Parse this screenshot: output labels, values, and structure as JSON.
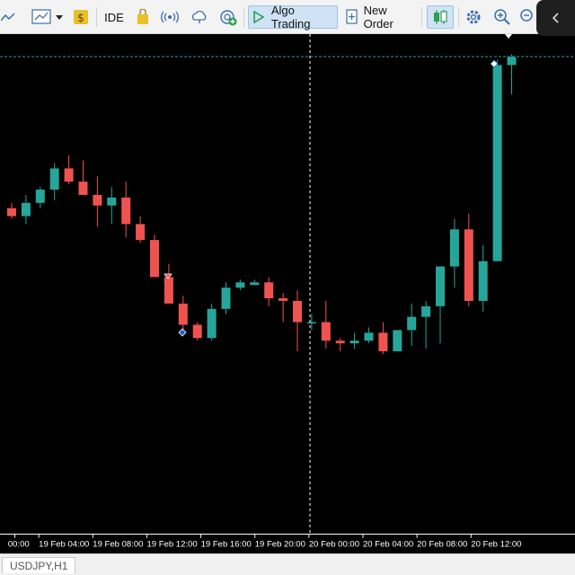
{
  "toolbar": {
    "ide_label": "IDE",
    "algo_label": "Algo Trading",
    "new_order_label": "New Order",
    "icons": [
      "line-chart-icon",
      "chart-menu-icon",
      "dollar-icon",
      "ide-button",
      "shopping-bag-icon",
      "signal-icon",
      "cloud-icon",
      "add-indicator-icon",
      "play-icon",
      "new-order-icon",
      "candlestick-icon",
      "settings-icon",
      "zoom-in-icon",
      "zoom-out-icon",
      "collapse-panel-icon"
    ]
  },
  "chart_data": {
    "type": "candlestick",
    "symbol": "USDJPY",
    "timeframe": "H1",
    "colors": {
      "up": "#26a69a",
      "down": "#ef5350",
      "background": "#000000",
      "crosshair": "#ffffff",
      "last_price_line": "#2aa198"
    },
    "y_range": [
      0,
      100
    ],
    "x_tick_labels": [
      "00:00",
      "19 Feb 04:00",
      "19 Feb 08:00",
      "19 Feb 12:00",
      "19 Feb 16:00",
      "19 Feb 20:00",
      "20 Feb 00:00",
      "20 Feb 04:00",
      "20 Feb 08:00",
      "20 Feb 12:00"
    ],
    "candles": [
      {
        "o": 34,
        "h": 36,
        "l": 30,
        "c": 31
      },
      {
        "o": 31,
        "h": 39,
        "l": 28,
        "c": 36
      },
      {
        "o": 36,
        "h": 42,
        "l": 34,
        "c": 41
      },
      {
        "o": 41,
        "h": 51,
        "l": 37,
        "c": 49
      },
      {
        "o": 49,
        "h": 54,
        "l": 43,
        "c": 44
      },
      {
        "o": 44,
        "h": 52,
        "l": 39,
        "c": 39
      },
      {
        "o": 39,
        "h": 46,
        "l": 27,
        "c": 35
      },
      {
        "o": 35,
        "h": 42,
        "l": 28,
        "c": 38
      },
      {
        "o": 38,
        "h": 44,
        "l": 23,
        "c": 28
      },
      {
        "o": 28,
        "h": 31,
        "l": 21,
        "c": 22
      },
      {
        "o": 22,
        "h": 24,
        "l": 10,
        "c": 8
      },
      {
        "o": 8,
        "h": 13,
        "l": 0,
        "c": -2
      },
      {
        "o": -2,
        "h": 1,
        "l": -14,
        "c": -10
      },
      {
        "o": -10,
        "h": -9,
        "l": -16,
        "c": -15
      },
      {
        "o": -15,
        "h": -2,
        "l": -16,
        "c": -4
      },
      {
        "o": -4,
        "h": 6,
        "l": -6,
        "c": 4
      },
      {
        "o": 4,
        "h": 7,
        "l": 3,
        "c": 6
      },
      {
        "o": 5,
        "h": 7,
        "l": 5,
        "c": 6
      },
      {
        "o": 6,
        "h": 8,
        "l": -3,
        "c": 0
      },
      {
        "o": 0,
        "h": 2,
        "l": -9,
        "c": -1
      },
      {
        "o": -1,
        "h": 3,
        "l": -20,
        "c": -9
      },
      {
        "o": -9,
        "h": -6,
        "l": -12,
        "c": -9
      },
      {
        "o": -9,
        "h": -1,
        "l": -19,
        "c": -16
      },
      {
        "o": -16,
        "h": -15,
        "l": -20,
        "c": -17
      },
      {
        "o": -17,
        "h": -13,
        "l": -19,
        "c": -16
      },
      {
        "o": -16,
        "h": -11,
        "l": -17,
        "c": -13
      },
      {
        "o": -13,
        "h": -9,
        "l": -21,
        "c": -20
      },
      {
        "o": -20,
        "h": -12,
        "l": -18,
        "c": -12
      },
      {
        "o": -12,
        "h": -2,
        "l": -18,
        "c": -7
      },
      {
        "o": -7,
        "h": -1,
        "l": -19,
        "c": -3
      },
      {
        "o": -3,
        "h": 1,
        "l": -17,
        "c": 12
      },
      {
        "o": 12,
        "h": 30,
        "l": 4,
        "c": 26
      },
      {
        "o": 26,
        "h": 32,
        "l": -3,
        "c": -1
      },
      {
        "o": -1,
        "h": 20,
        "l": -5,
        "c": 14
      },
      {
        "o": 14,
        "h": 90,
        "l": 14,
        "c": 88
      },
      {
        "o": 88,
        "h": 92,
        "l": 77,
        "c": 91
      }
    ]
  },
  "statusbar": {
    "symbol_tab": "USDJPY,H1"
  }
}
